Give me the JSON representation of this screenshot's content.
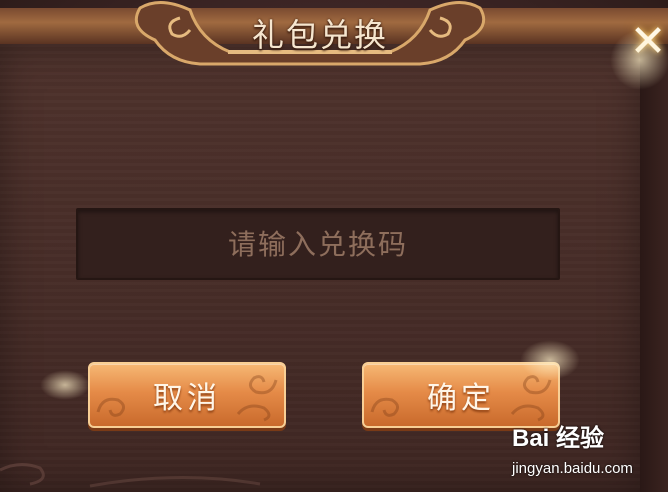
{
  "dialog": {
    "title": "礼包兑换",
    "close_icon": "close-x-icon"
  },
  "code_input": {
    "placeholder": "请输入兑换码",
    "value": ""
  },
  "buttons": {
    "cancel_label": "取消",
    "confirm_label": "确定"
  },
  "watermark": {
    "logo_text": "Bai 经验",
    "url_text": "jingyan.baidu.com"
  },
  "colors": {
    "panel": "#472d28",
    "button": "#e58b48",
    "title_text": "#f6e6cf"
  }
}
